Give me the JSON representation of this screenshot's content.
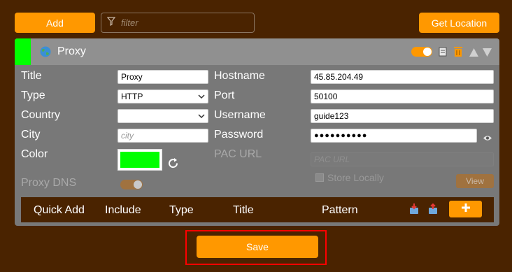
{
  "toolbar": {
    "add_label": "Add",
    "filter_placeholder": "filter",
    "get_location_label": "Get Location"
  },
  "proxy": {
    "name": "Proxy",
    "strip_color": "#00ff00",
    "enabled": true,
    "fields": {
      "title_label": "Title",
      "title_value": "Proxy",
      "type_label": "Type",
      "type_value": "HTTP",
      "country_label": "Country",
      "country_value": "",
      "city_label": "City",
      "city_placeholder": "city",
      "color_label": "Color",
      "color_value": "#00ff00",
      "proxy_dns_label": "Proxy DNS",
      "hostname_label": "Hostname",
      "hostname_value": "45.85.204.49",
      "port_label": "Port",
      "port_value": "50100",
      "username_label": "Username",
      "username_value": "guide123",
      "password_label": "Password",
      "password_value": "●●●●●●●●●●",
      "pac_url_label": "PAC URL",
      "pac_url_placeholder": "PAC URL",
      "store_locally_label": "Store Locally",
      "view_label": "View"
    },
    "pattern_table": {
      "headers": [
        "Quick Add",
        "Include",
        "Type",
        "Title",
        "Pattern"
      ]
    }
  },
  "footer": {
    "save_label": "Save"
  },
  "colors": {
    "background": "#4a2300",
    "accent": "#ff9800",
    "highlight_outline": "#ff0000"
  }
}
